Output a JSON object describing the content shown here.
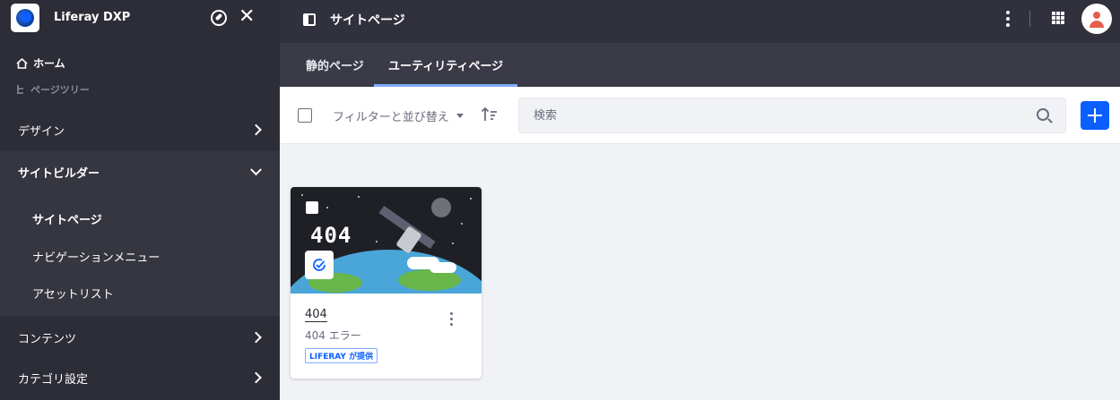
{
  "app": {
    "name": "Liferay DXP"
  },
  "sidebar": {
    "home_label": "ホーム",
    "tree_label": "ページツリー",
    "sections": [
      {
        "label": "デザイン"
      },
      {
        "label": "サイトビルダー"
      },
      {
        "label": "コンテンツ"
      },
      {
        "label": "カテゴリ設定"
      }
    ],
    "site_builder_items": [
      {
        "label": "サイトページ"
      },
      {
        "label": "ナビゲーションメニュー"
      },
      {
        "label": "アセットリスト"
      }
    ]
  },
  "header": {
    "title": "サイトページ"
  },
  "tabs": [
    {
      "label": "静的ページ"
    },
    {
      "label": "ユーティリティページ"
    }
  ],
  "toolbar": {
    "filter_label": "フィルターと並び替え",
    "search_placeholder": "検索"
  },
  "card": {
    "image_text": "404",
    "title": "404",
    "subtitle": "404 エラー",
    "label": "LIFERAY が提供"
  },
  "colors": {
    "sidebar_bg": "#2c2d36",
    "topbar_bg": "#30313d",
    "tabbar_bg": "#3a3b46",
    "accent": "#0b5fff",
    "tab_underline": "#80acff",
    "avatar_icon": "#e85c4a"
  },
  "icons": [
    "liferay-logo-icon",
    "compass-icon",
    "close-icon",
    "home-icon",
    "page-tree-icon",
    "chevron-right-icon",
    "chevron-down-icon",
    "sidebar-panel-icon",
    "kebab-icon",
    "apps-grid-icon",
    "user-avatar-icon",
    "checkbox-icon",
    "caret-down-icon",
    "sort-icon",
    "search-icon",
    "plus-icon",
    "check-circle-icon"
  ]
}
